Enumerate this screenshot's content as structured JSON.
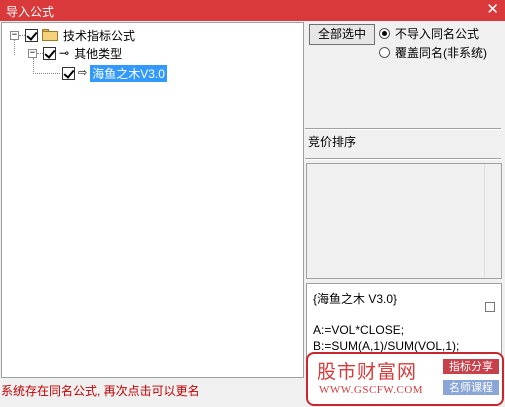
{
  "window": {
    "title": "导入公式",
    "close_glyph": "✕"
  },
  "tree": {
    "root": {
      "label": "技术指标公式",
      "expander": "−",
      "checked": true,
      "icon": "folder-icon"
    },
    "group": {
      "label": "其他类型",
      "expander": "−",
      "checked": true,
      "icon": "key-icon"
    },
    "item": {
      "label": "海鱼之木V3.0",
      "checked": true,
      "selected": true,
      "icon": "formula-file-icon"
    }
  },
  "controls": {
    "select_all_label": "全部选中",
    "radio_options": [
      {
        "label": "不导入同名公式",
        "selected": true
      },
      {
        "label": "覆盖同名(非系统)",
        "selected": false
      }
    ]
  },
  "section": {
    "title": "竞价排序"
  },
  "code": {
    "lines": [
      "{海鱼之木 V3.0}",
      "",
      "A:=VOL*CLOSE;",
      "B:=SUM(A,1)/SUM(VOL,1);"
    ]
  },
  "watermark": {
    "brand": "股市财富网",
    "url": "WWW.GSCFW.COM",
    "badge1": "指标分享",
    "badge2": "名师课程",
    "color": "#d93b3b"
  },
  "status": {
    "message": "系统存在同名公式, 再次点击可以更名"
  }
}
